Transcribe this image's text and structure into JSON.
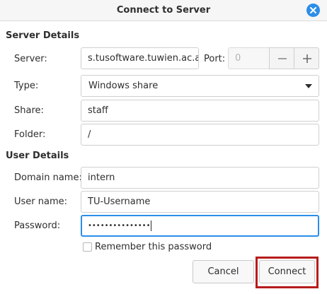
{
  "dialog": {
    "title": "Connect to Server",
    "close_icon": "close-icon",
    "accent_color": "#2b8ee8"
  },
  "server_details": {
    "heading": "Server Details",
    "server_label": "Server:",
    "server_value": "s.tusoftware.tuwien.ac.at",
    "port_label": "Port:",
    "port_placeholder": "0",
    "port_decrement_icon": "minus-icon",
    "port_increment_icon": "plus-icon",
    "type_label": "Type:",
    "type_value": "Windows share",
    "share_label": "Share:",
    "share_value": "staff",
    "folder_label": "Folder:",
    "folder_value": "/"
  },
  "user_details": {
    "heading": "User Details",
    "domain_label": "Domain name:",
    "domain_value": "intern",
    "username_label": "User name:",
    "username_value": "TU-Username",
    "password_label": "Password:",
    "password_value": "•••••••••••••••",
    "remember_label": "Remember this password",
    "remember_checked": false
  },
  "actions": {
    "cancel_label": "Cancel",
    "connect_label": "Connect",
    "highlight_color": "#b71c1c"
  }
}
